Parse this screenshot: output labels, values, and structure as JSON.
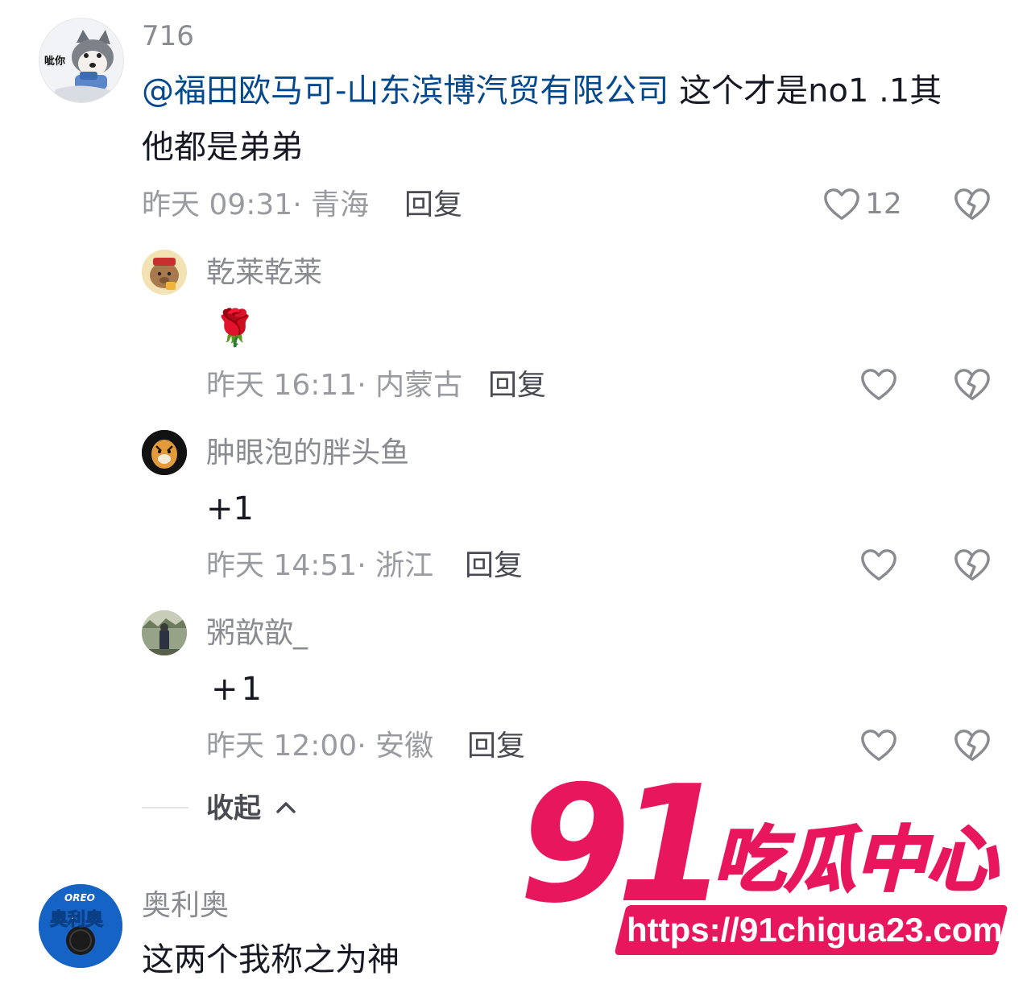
{
  "top_comment": {
    "username": "716",
    "avatar_caption": "呲你",
    "mention": "@福田欧马可-山东滨博汽贸有限公司",
    "text_line1": " 这个才是no1 .1其",
    "text_line2": "他都是弟弟",
    "time": "昨天 09:31",
    "location": "青海",
    "reply_label": "回复",
    "like_count": "12"
  },
  "replies": [
    {
      "username": "乾莱乾莱",
      "content": "🌹",
      "time": "昨天 16:11",
      "location": "内蒙古",
      "reply_label": "回复"
    },
    {
      "username": "肿眼泡的胖头鱼",
      "content": "+1",
      "time": "昨天 14:51",
      "location": "浙江",
      "reply_label": "回复"
    },
    {
      "username": "粥歆歆_",
      "content": "+1",
      "time": "昨天 12:00",
      "location": "安徽",
      "reply_label": "回复"
    }
  ],
  "collapse_label": "收起",
  "next_comment": {
    "username": "奥利奥",
    "avatar_brand": "OREO",
    "avatar_caption": "奥利奥",
    "text": "这两个我称之为神"
  },
  "watermark": {
    "number": "91",
    "title": "吃瓜中心",
    "url": "https://91chigua23.com"
  },
  "colors": {
    "mention": "#04498d",
    "watermark": "#e8175d",
    "meta": "#9a9ba1"
  },
  "icons": {
    "like": "heart-outline-icon",
    "dislike": "broken-heart-icon",
    "collapse": "chevron-up-icon"
  }
}
